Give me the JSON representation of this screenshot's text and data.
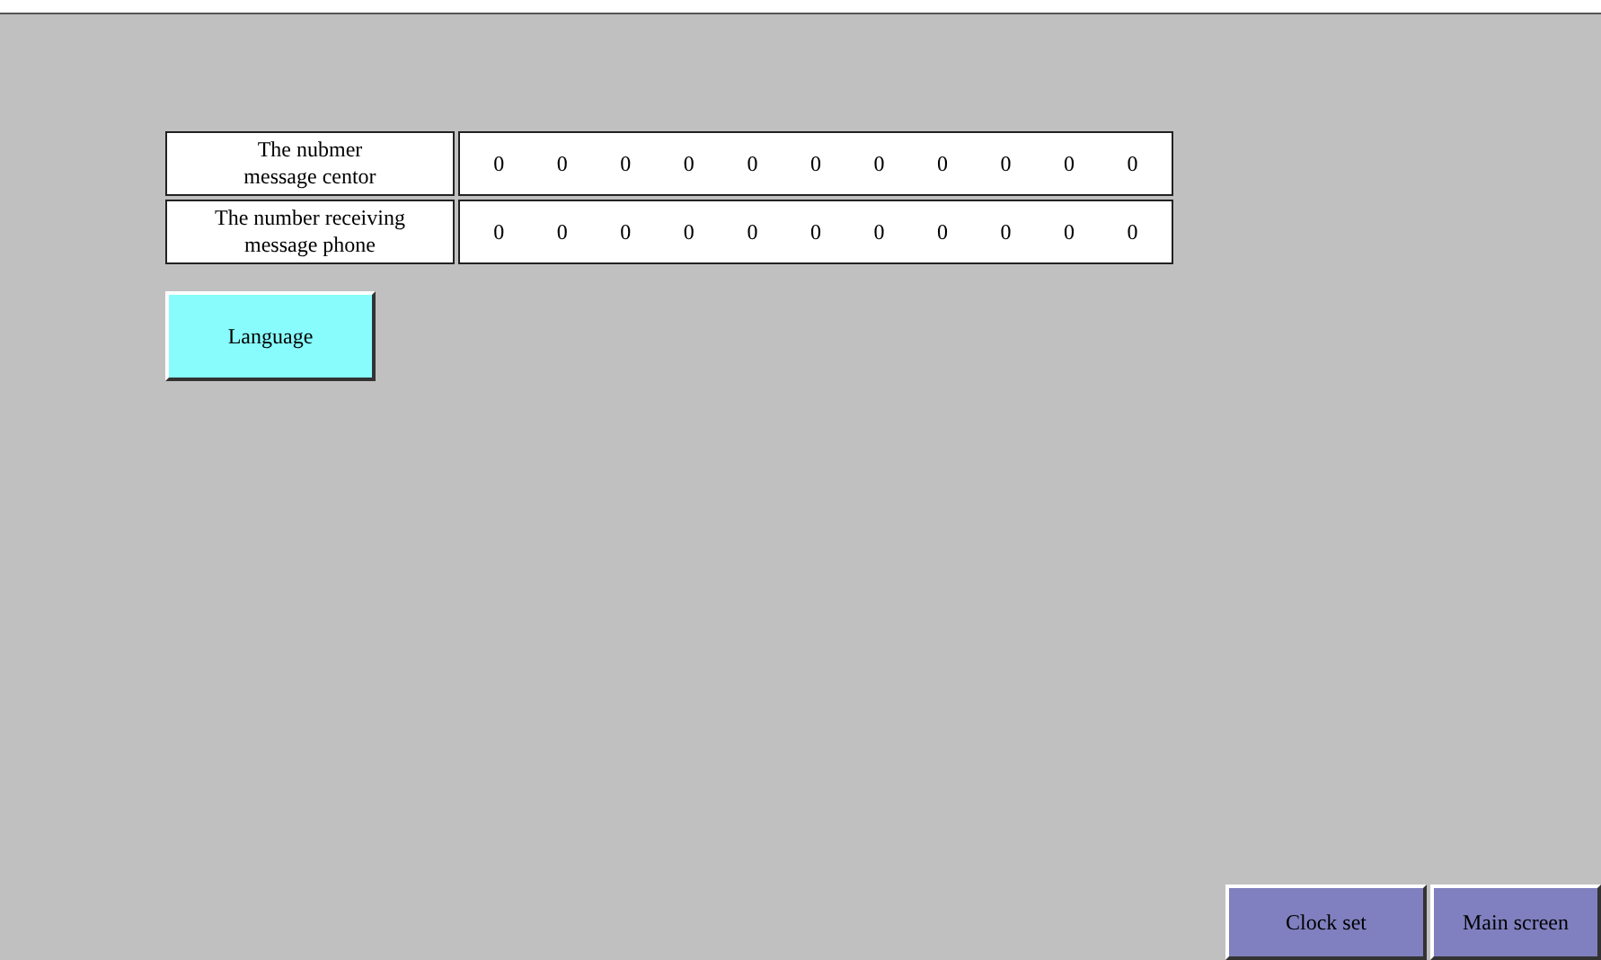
{
  "number_rows": [
    {
      "label": "The nubmer\nmessage centor",
      "digits": [
        "0",
        "0",
        "0",
        "0",
        "0",
        "0",
        "0",
        "0",
        "0",
        "0",
        "0"
      ]
    },
    {
      "label": "The number receiving\nmessage phone",
      "digits": [
        "0",
        "0",
        "0",
        "0",
        "0",
        "0",
        "0",
        "0",
        "0",
        "0",
        "0"
      ]
    }
  ],
  "language_button": "Language",
  "nav_buttons": [
    "Clock set",
    "Main screen"
  ]
}
